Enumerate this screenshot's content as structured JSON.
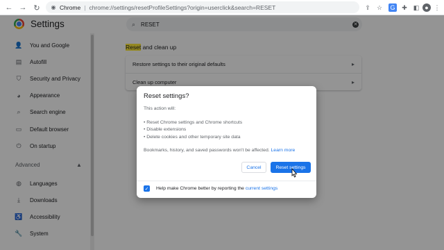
{
  "browser": {
    "site_name": "Chrome",
    "url": "chrome://settings/resetProfileSettings?origin=userclick&search=RESET"
  },
  "sidebar": {
    "title": "Settings",
    "items": [
      {
        "label": "You and Google",
        "icon": "person-icon"
      },
      {
        "label": "Autofill",
        "icon": "clipboard-icon"
      },
      {
        "label": "Security and Privacy",
        "icon": "shield-icon"
      },
      {
        "label": "Appearance",
        "icon": "palette-icon"
      },
      {
        "label": "Search engine",
        "icon": "search-icon"
      },
      {
        "label": "Default browser",
        "icon": "browser-icon"
      },
      {
        "label": "On startup",
        "icon": "power-icon"
      }
    ],
    "advanced_label": "Advanced",
    "advanced_items": [
      {
        "label": "Languages",
        "icon": "globe-icon"
      },
      {
        "label": "Downloads",
        "icon": "download-icon"
      },
      {
        "label": "Accessibility",
        "icon": "accessibility-icon"
      },
      {
        "label": "System",
        "icon": "wrench-icon"
      }
    ]
  },
  "search": {
    "value": "RESET"
  },
  "section": {
    "title_highlight": "Reset",
    "title_rest": " and clean up",
    "rows": [
      {
        "label": "Restore settings to their original defaults"
      },
      {
        "label": "Clean up computer"
      }
    ]
  },
  "dialog": {
    "title": "Reset settings?",
    "intro": "This action will:",
    "bullets": [
      "• Reset Chrome settings and Chrome shortcuts",
      "• Disable extensions",
      "• Delete cookies and other temporary site data"
    ],
    "note": "Bookmarks, history, and saved passwords won't be affected.",
    "learn_more": "Learn more",
    "cancel_label": "Cancel",
    "reset_label": "Reset settings",
    "footer_text": "Help make Chrome better by reporting the ",
    "footer_link": "current settings",
    "checkbox_checked": true
  },
  "colors": {
    "accent": "#1a73e8",
    "highlight": "#ffeb3b"
  }
}
